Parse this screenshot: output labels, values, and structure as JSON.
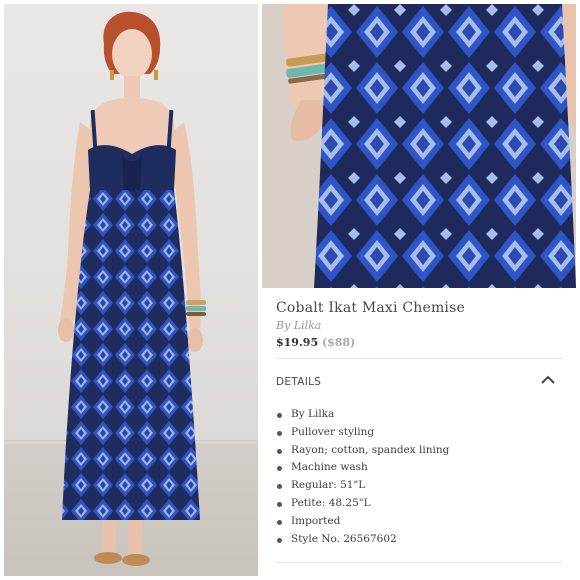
{
  "product": {
    "title": "Cobalt Ikat Maxi Chemise",
    "brand": "By Lilka",
    "price_sale": "$19.95",
    "price_original": "($88)"
  },
  "details": {
    "heading": "DETAILS",
    "toggle_icon": "chevron-up-icon",
    "items": [
      "By Lilka",
      "Pullover styling",
      "Rayon; cotton, spandex lining",
      "Machine wash",
      "Regular: 51\"L",
      "Petite: 48.25\"L",
      "Imported",
      "Style No. 26567602"
    ]
  },
  "images": {
    "left": "model-full-length-photo",
    "right": "fabric-closeup-photo"
  },
  "colors": {
    "navy": "#1f2c5e",
    "cobalt": "#2f54c6",
    "wall": "#e6e4e2"
  }
}
